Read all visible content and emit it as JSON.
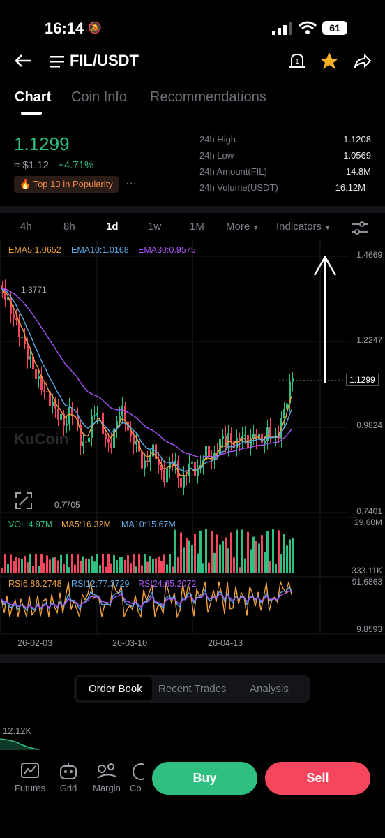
{
  "status_bar": {
    "time": "16:14",
    "battery": "61"
  },
  "header": {
    "title": "FIL/USDT"
  },
  "tabs": [
    "Chart",
    "Coin Info",
    "Recommendations"
  ],
  "ticker": {
    "last_price": "1.1299",
    "usd_price": "≈ $1.12",
    "change": "+4.71%",
    "badge": "Top 13 in Popularity",
    "more": "···",
    "stats": [
      {
        "label": "24h High",
        "value": "1.1208"
      },
      {
        "label": "24h Low",
        "value": "1.0569"
      },
      {
        "label": "24h Amount(FIL)",
        "value": "14.8M"
      },
      {
        "label": "24h Volume(USDT)",
        "value": "16.12M"
      }
    ]
  },
  "timeframes": [
    "4h",
    "8h",
    "1d",
    "1w",
    "1M"
  ],
  "toolbar": {
    "more": "More",
    "indicators": "Indicators"
  },
  "chart_data": {
    "type": "candlestick",
    "ema_legend": {
      "ema5": "EMA5:1.0652",
      "ema10": "EMA10:1.0168",
      "ema30": "EMA30:0.9575"
    },
    "price_axis": [
      "1.4669",
      "1.2247",
      "0.9824",
      "0.7401"
    ],
    "current_price_label": "1.1299",
    "annotations": {
      "high": "1.3771",
      "low": "0.7705"
    },
    "volume_legend": {
      "vol": "VOL:4.97M",
      "ma5": "MA5:16.32M",
      "ma10": "MA10:15.67M"
    },
    "volume_axis": [
      "29.60M",
      "333.11K"
    ],
    "rsi_legend": {
      "rsi6": "RSI6:86.2748",
      "rsi12": "RSI12:77.3729",
      "rsi24": "RSI24:65.2072"
    },
    "rsi_axis": [
      "91.6863",
      "9.8593"
    ],
    "x_labels": [
      "26-02-03",
      "26-03-10",
      "26-04-13"
    ],
    "watermark": "KuCoin",
    "colors": {
      "up": "#2fbf81",
      "down": "#f6465d",
      "ema5": "#f0a03c",
      "ema10": "#5aa9e6",
      "ema30": "#a855f7"
    }
  },
  "bottom_tabs": [
    "Order Book",
    "Recent Trades",
    "Analysis"
  ],
  "depth_label": "12.12K",
  "dock": [
    {
      "label": "Futures",
      "icon": "futures-icon"
    },
    {
      "label": "Grid",
      "icon": "grid-bot-icon"
    },
    {
      "label": "Margin",
      "icon": "margin-icon"
    },
    {
      "label": "Co",
      "icon": "copy-icon"
    }
  ],
  "actions": {
    "buy": "Buy",
    "sell": "Sell"
  }
}
